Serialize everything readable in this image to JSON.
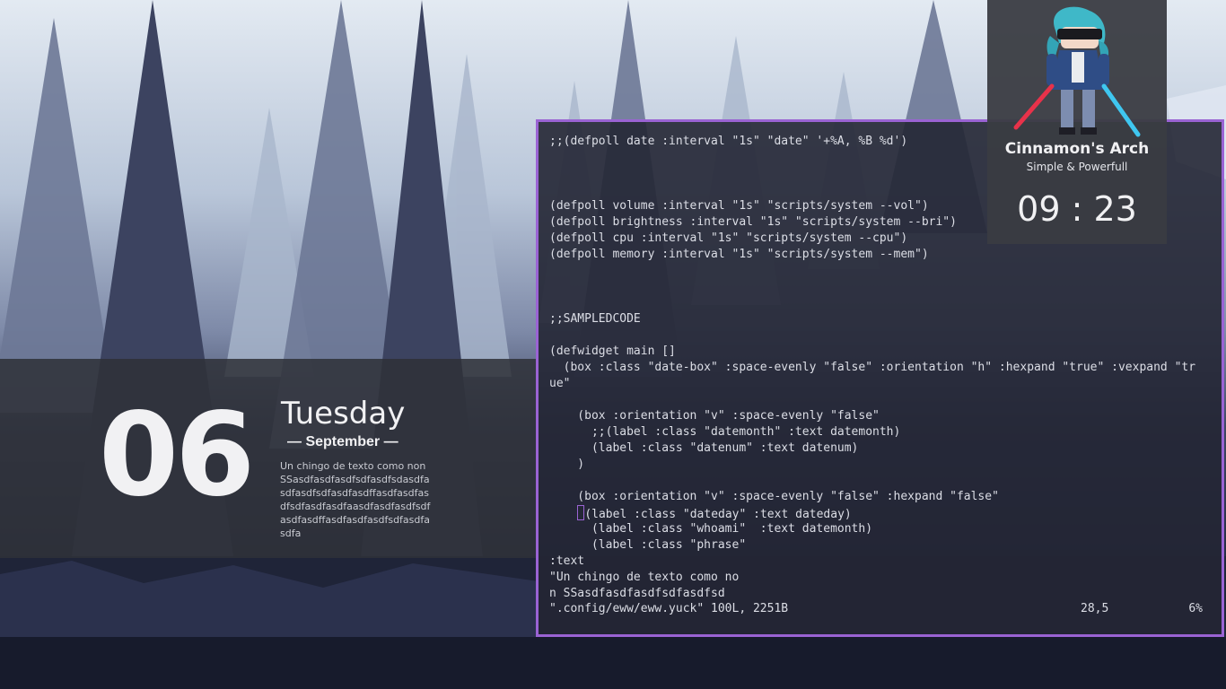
{
  "date_widget": {
    "day_number": "06",
    "weekday": "Tuesday",
    "month": "— September —",
    "phrase": "Un chingo de texto como non SSasdfasdfasdfsdfasdfsdasdfasdfasdfsdfasdfasdffasdfasdfasdfsdfasdfasdfaasdfasdfasdfsdfasdfasdffasdfasdfasdfsdfasdfasdfa"
  },
  "profile_widget": {
    "name": "Cinnamon's Arch",
    "tagline": "Simple & Powerfull",
    "clock": "09 : 23"
  },
  "terminal": {
    "lines": [
      ";;(defpoll date :interval \"1s\" \"date\" '+%A, %B %d')",
      "",
      "",
      "",
      "(defpoll volume :interval \"1s\" \"scripts/system --vol\")",
      "(defpoll brightness :interval \"1s\" \"scripts/system --bri\")",
      "(defpoll cpu :interval \"1s\" \"scripts/system --cpu\")",
      "(defpoll memory :interval \"1s\" \"scripts/system --mem\")",
      "",
      "",
      "",
      ";;SAMPLEDCODE",
      "",
      "(defwidget main []",
      "  (box :class \"date-box\" :space-evenly \"false\" :orientation \"h\" :hexpand \"true\" :vexpand \"tr",
      "ue\"",
      "",
      "    (box :orientation \"v\" :space-evenly \"false\"",
      "      ;;(label :class \"datemonth\" :text datemonth)",
      "      (label :class \"datenum\" :text datenum)",
      "    )",
      "",
      "    (box :orientation \"v\" :space-evenly \"false\" :hexpand \"false\"",
      "      (label :class \"dateday\" :text dateday)",
      "      (label :class \"whoami\"  :text datemonth)",
      "      (label :class \"phrase\"",
      ":text",
      "\"Un chingo de texto como no",
      "n SSasdfasdfasdfsdfasdfsd"
    ],
    "cursor_line_index": 23,
    "status_file": "\".config/eww/eww.yuck\" 100L, 2251B",
    "status_position": "28,5",
    "status_percent": "6%"
  },
  "colors": {
    "accent_border": "#9a63d3",
    "widget_bg": "#2e3138",
    "terminal_bg": "#232634",
    "text": "#dcdee6"
  }
}
